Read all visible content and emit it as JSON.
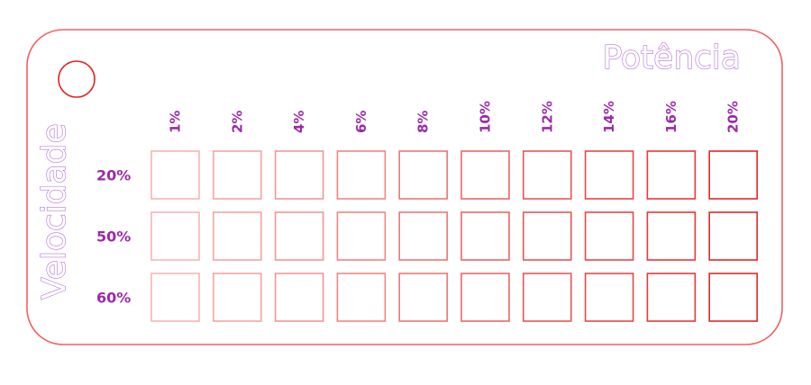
{
  "title": "Potência",
  "side_label": "Velocidade",
  "columns": [
    "1%",
    "2%",
    "4%",
    "6%",
    "8%",
    "10%",
    "12%",
    "14%",
    "16%",
    "20%"
  ],
  "rows": [
    "20%",
    "50%",
    "60%"
  ],
  "colors": {
    "plate_outline": "#f06060",
    "hole_outline": "#e02020",
    "cell_light": "#f8b4b4",
    "cell_dark": "#e02828",
    "title_stroke": "#b36fd6",
    "label_text": "#9b2aa8"
  }
}
